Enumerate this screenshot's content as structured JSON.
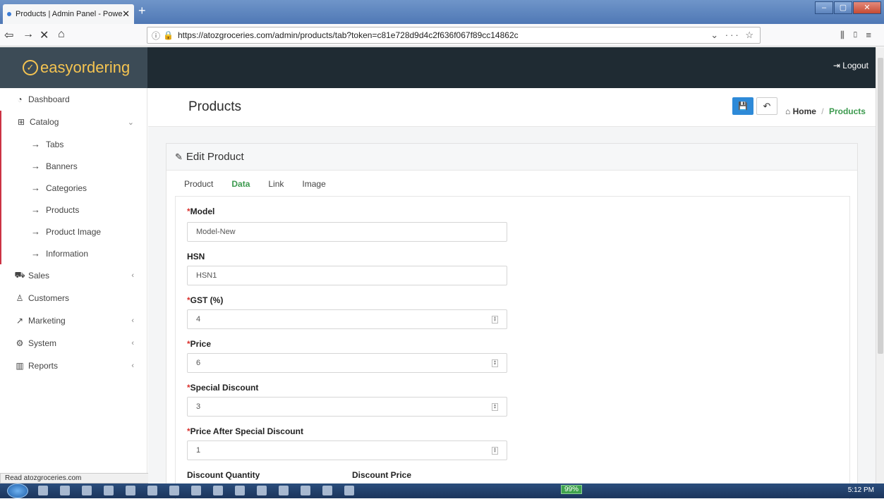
{
  "browser": {
    "tab_title": "Products | Admin Panel - Powe",
    "tab_close": "✕",
    "new_tab": "+",
    "url": "https://atozgroceries.com/admin/products/tab?token=c81e728d9d4c2f636f067f89cc14862c",
    "url_actions": "⌄ ··· ☆",
    "status_text": "Read atozgroceries.com",
    "window_controls": [
      "–",
      "▢",
      "✕"
    ]
  },
  "header": {
    "logo_text": "easyordering",
    "logout_label": "Logout"
  },
  "sidebar": {
    "items": [
      {
        "label": "Dashboard",
        "icon": "dashboard-icon"
      },
      {
        "label": "Catalog",
        "icon": "catalog-icon"
      },
      {
        "label": "Sales",
        "icon": "cart-icon"
      },
      {
        "label": "Customers",
        "icon": "user-icon"
      },
      {
        "label": "Marketing",
        "icon": "share-icon"
      },
      {
        "label": "System",
        "icon": "gear-icon"
      },
      {
        "label": "Reports",
        "icon": "bar-chart-icon"
      }
    ],
    "catalog_children": [
      "Tabs",
      "Banners",
      "Categories",
      "Products",
      "Product Image",
      "Information"
    ]
  },
  "page": {
    "title": "Products",
    "breadcrumb_home": "Home",
    "breadcrumb_current": "Products",
    "panel_title": "Edit Product",
    "tabs": [
      "Product",
      "Data",
      "Link",
      "Image"
    ],
    "active_tab": "Data"
  },
  "form": {
    "fields": [
      {
        "label": "Model",
        "required": true,
        "value": "Model-New"
      },
      {
        "label": "HSN",
        "required": false,
        "value": "HSN1"
      },
      {
        "label": "GST (%)",
        "required": true,
        "value": "4"
      },
      {
        "label": "Price",
        "required": true,
        "value": "6"
      },
      {
        "label": "Special Discount",
        "required": true,
        "value": "3"
      },
      {
        "label": "Price After Special Discount",
        "required": true,
        "value": "1"
      }
    ],
    "discount_quantity_label": "Discount Quantity",
    "discount_price_label": "Discount Price"
  },
  "taskbar": {
    "battery": "99%",
    "clock": "5:12 PM"
  },
  "colors": {
    "header_bg": "#1f2b33",
    "logo_bg": "#3c4b56",
    "logo_color": "#f5c451",
    "accent_green": "#3c9a4e",
    "save_blue": "#2e8ad8",
    "required_red": "#d9302c"
  }
}
